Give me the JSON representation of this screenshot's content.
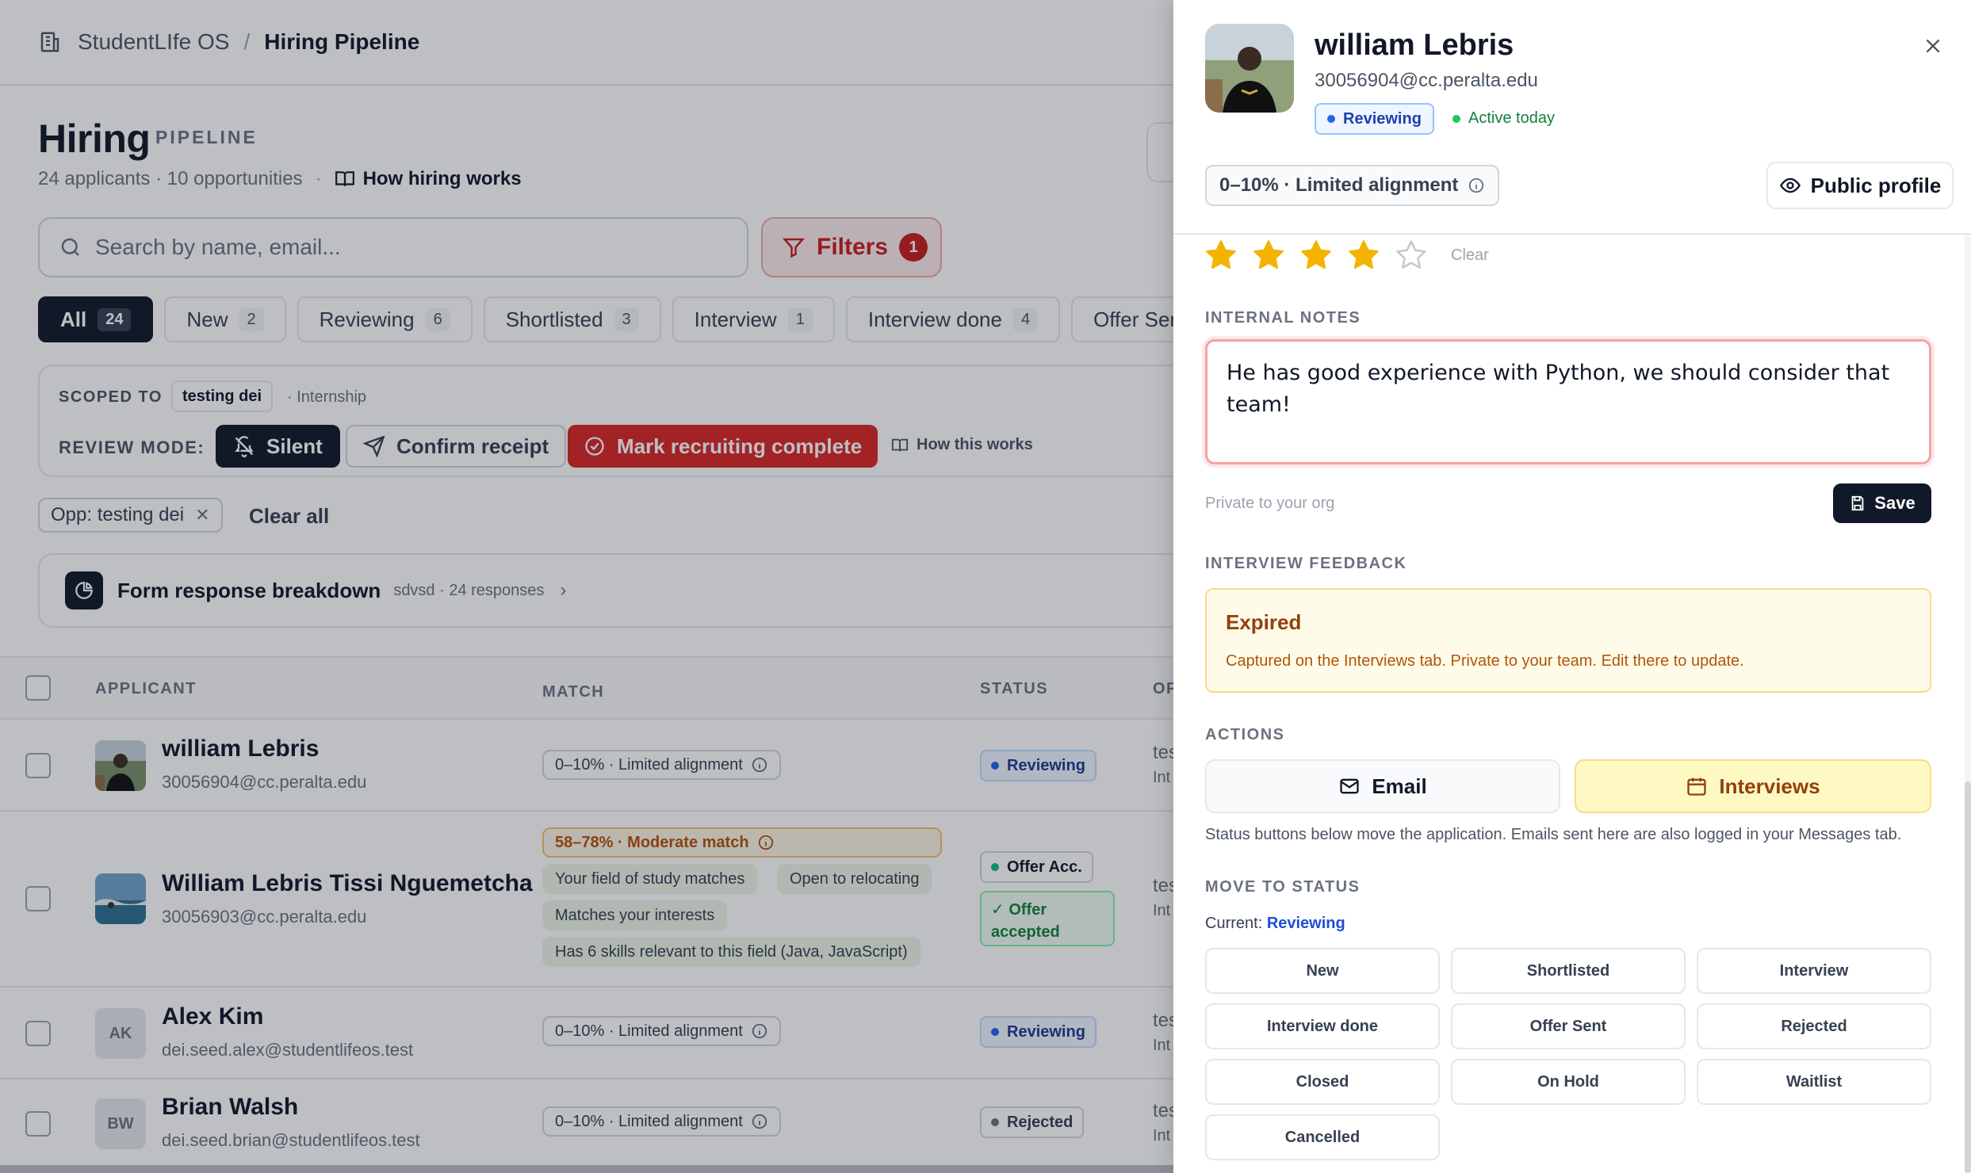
{
  "breadcrumb": {
    "app": "StudentLIfe OS",
    "section": "Hiring Pipeline"
  },
  "header": {
    "title": "Hiring",
    "eyebrow": "PIPELINE",
    "summary": "24 applicants · 10 opportunities",
    "how_link": "How hiring works"
  },
  "search": {
    "placeholder": "Search by name, email..."
  },
  "filters": {
    "label": "Filters",
    "count": "1"
  },
  "tabs": [
    {
      "label": "All",
      "count": "24"
    },
    {
      "label": "New",
      "count": "2"
    },
    {
      "label": "Reviewing",
      "count": "6"
    },
    {
      "label": "Shortlisted",
      "count": "3"
    },
    {
      "label": "Interview",
      "count": "1"
    },
    {
      "label": "Interview done",
      "count": "4"
    },
    {
      "label": "Offer Sent"
    }
  ],
  "scope": {
    "label": "SCOPED TO",
    "chip": "testing dei",
    "type": "· Internship",
    "review_mode_label": "REVIEW MODE:",
    "silent": "Silent",
    "confirm": "Confirm receipt",
    "mark": "Mark recruiting complete",
    "how": "How this works"
  },
  "active_filters": {
    "chip": "Opp: testing dei",
    "clear_all": "Clear all"
  },
  "form_breakdown": {
    "title": "Form response breakdown",
    "subtitle": "sdvsd · 24 responses"
  },
  "table": {
    "headers": {
      "applicant": "APPLICANT",
      "match": "MATCH",
      "status": "STATUS",
      "opp": "OP"
    },
    "rows": [
      {
        "name": "william Lebris",
        "email": "30056904@cc.peralta.edu",
        "match": "0–10% · Limited alignment",
        "status": "Reviewing",
        "opp": "tes",
        "opp2": "Int"
      },
      {
        "name": "William Lebris Tissi Nguemetcha",
        "email": "30056903@cc.peralta.edu",
        "match": "58–78% · Moderate match",
        "tags": [
          "Your field of study matches",
          "Open to relocating",
          "Matches your interests",
          "Has 6 skills relevant to this field (Java, JavaScript)"
        ],
        "status": "Offer Acc.",
        "status2": "Offer accepted",
        "opp": "tes",
        "opp2": "Int"
      },
      {
        "name": "Alex Kim",
        "initials": "AK",
        "email": "dei.seed.alex@studentlifeos.test",
        "match": "0–10% · Limited alignment",
        "status": "Reviewing",
        "opp": "tes",
        "opp2": "Int"
      },
      {
        "name": "Brian Walsh",
        "initials": "BW",
        "email": "dei.seed.brian@studentlifeos.test",
        "match": "0–10% · Limited alignment",
        "status": "Rejected",
        "opp": "tes",
        "opp2": "Int"
      }
    ]
  },
  "panel": {
    "name": "william Lebris",
    "email": "30056904@cc.peralta.edu",
    "status": "Reviewing",
    "activity": "Active today",
    "alignment": "0–10% · Limited alignment",
    "public_profile": "Public profile",
    "rating": 4,
    "rating_max": 5,
    "clear_rating": "Clear",
    "notes_label": "INTERNAL NOTES",
    "notes_value": "He has good experience with Python, we should consider that team!",
    "notes_hint": "Private to your org",
    "save": "Save",
    "feedback_label": "INTERVIEW FEEDBACK",
    "feedback_title": "Expired",
    "feedback_desc": "Captured on the Interviews tab. Private to your team. Edit there to update.",
    "actions_label": "ACTIONS",
    "email_btn": "Email",
    "interviews_btn": "Interviews",
    "actions_note": "Status buttons below move the application. Emails sent here are also logged in your Messages tab.",
    "move_label": "MOVE TO STATUS",
    "current_label": "Current:",
    "current_value": "Reviewing",
    "statuses": [
      "New",
      "Shortlisted",
      "Interview",
      "Interview done",
      "Offer Sent",
      "Rejected",
      "Closed",
      "On Hold",
      "Waitlist",
      "Cancelled"
    ]
  },
  "colors": {
    "accent": "#111827",
    "danger": "#dc2626",
    "reviewing": "#2563eb",
    "star": "#f5b301"
  }
}
